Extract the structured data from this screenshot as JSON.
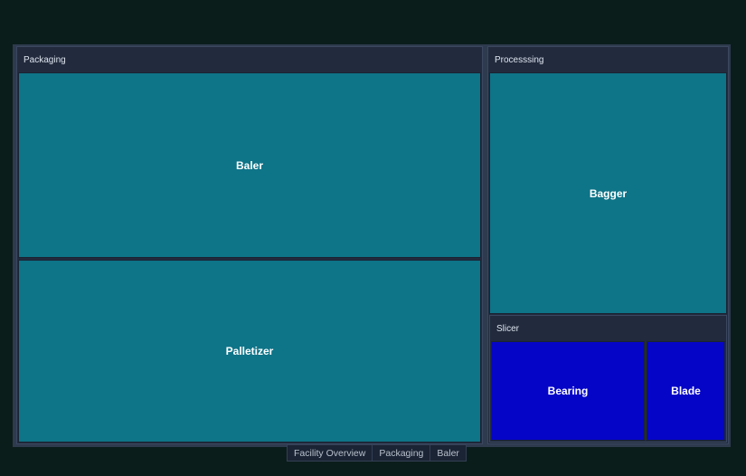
{
  "chart_data": {
    "type": "treemap",
    "groups": [
      {
        "name": "Packaging",
        "color": "#0e7488",
        "children": [
          {
            "name": "Baler"
          },
          {
            "name": "Palletizer"
          }
        ]
      },
      {
        "name": "Processsing",
        "children": [
          {
            "name": "Bagger",
            "color": "#0e7488"
          },
          {
            "name": "Slicer",
            "color": "#0505c8",
            "children": [
              {
                "name": "Bearing"
              },
              {
                "name": "Blade"
              }
            ]
          }
        ]
      }
    ],
    "breadcrumb": [
      "Facility Overview",
      "Packaging",
      "Baler"
    ]
  }
}
